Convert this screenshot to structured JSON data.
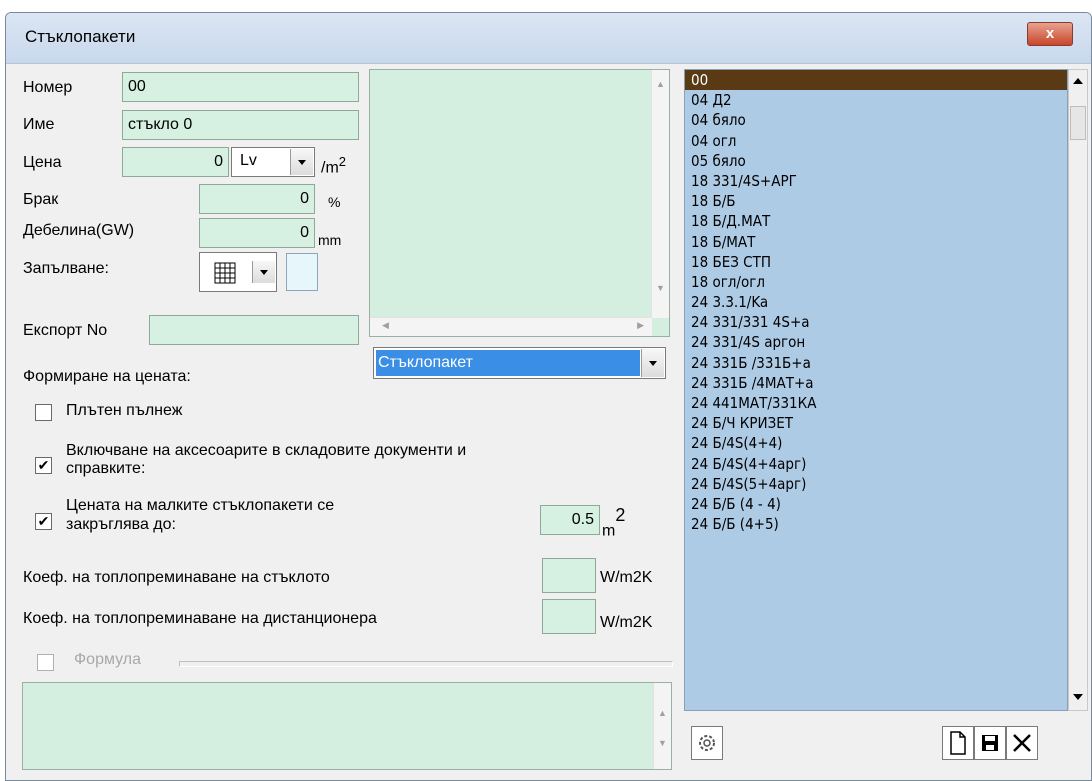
{
  "window": {
    "title": "Стъклопакети",
    "close_glyph": "x"
  },
  "form": {
    "number_label": "Номер",
    "number_value": "00",
    "name_label": "Име",
    "name_value": "стъкло 0",
    "price_label": "Цена",
    "price_value": "0",
    "currency_value": "Lv",
    "price_unit": "/m",
    "price_unit_sup": "2",
    "defect_label": "Брак",
    "defect_value": "0",
    "defect_unit": "%",
    "thickness_label": "Дебелина(GW)",
    "thickness_value": "0",
    "thickness_unit": "mm",
    "fill_label": "Запълване:",
    "export_label": "Експорт No",
    "export_value": "",
    "type_value": "Стъклопакет",
    "pricing_label": "Формиране на цената:",
    "solid_fill_label": "Плътен пълнеж",
    "include_accessories_label_1": "Включване на аксесоарите в складовите документи и",
    "include_accessories_label_2": "справките:",
    "round_price_label_1": "Цената на малките стъклопакети се",
    "round_price_label_2": "закръглява до:",
    "round_value": "0.5",
    "round_unit": "m",
    "round_unit_sup": "2",
    "coef_glass_label": "Коеф. на топлопреминаване на стъклото",
    "coef_glass_unit": "W/m2K",
    "coef_spacer_label": "Коеф. на топлопреминаване на дистанционера",
    "coef_spacer_unit": "W/m2K",
    "formula_label": "Формула"
  },
  "checkboxes": {
    "solid_fill": false,
    "include_accessories": true,
    "round_price": true,
    "formula": false
  },
  "list": {
    "items": [
      "00",
      "04 Д2",
      "04 бяло",
      "04 огл",
      "05 бяло",
      "18 331/4S+АРГ",
      "18 Б/Б",
      "18 Б/Д.МАТ",
      "18 Б/МАТ",
      "18 БЕЗ СТП",
      "18 огл/огл",
      "24 3.3.1/Ka",
      "24 331/331 4S+a",
      "24 331/4S аргон",
      "24 331Б /331Б+а",
      "24 331Б /4МАТ+а",
      "24 441МАТ/331КА",
      "24 Б/Ч КРИЗЕТ",
      "24 Б/4S(4+4)",
      "24 Б/4S(4+4арг)",
      "24 Б/4S(5+4арг)",
      "24 Б/Б (4 - 4)",
      "24 Б/Б (4+5)"
    ],
    "selected_index": 0
  },
  "toolbar": {
    "settings_icon": "gear-icon",
    "new_icon": "new-document-icon",
    "save_icon": "save-icon",
    "delete_icon": "delete-icon"
  }
}
